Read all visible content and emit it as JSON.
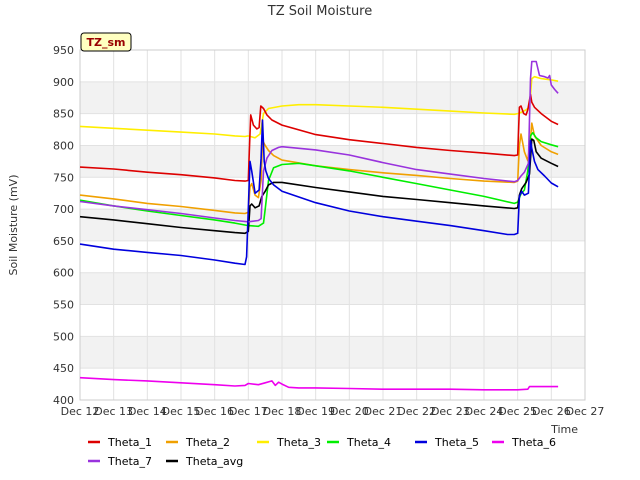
{
  "chart_data": {
    "type": "line",
    "title": "TZ Soil Moisture",
    "xlabel": "Time",
    "ylabel": "Soil Moisture (mV)",
    "badge": "TZ_sm",
    "xlim": [
      12,
      27
    ],
    "ylim": [
      400,
      950
    ],
    "x_ticks": [
      12,
      13,
      14,
      15,
      16,
      17,
      18,
      19,
      20,
      21,
      22,
      23,
      24,
      25,
      26,
      27
    ],
    "x_tick_labels": [
      "Dec 12",
      "Dec 13",
      "Dec 14",
      "Dec 15",
      "Dec 16",
      "Dec 17",
      "Dec 18",
      "Dec 19",
      "Dec 20",
      "Dec 21",
      "Dec 22",
      "Dec 23",
      "Dec 24",
      "Dec 25",
      "Dec 26",
      "Dec 27"
    ],
    "y_ticks": [
      400,
      450,
      500,
      550,
      600,
      650,
      700,
      750,
      800,
      850,
      900,
      950
    ],
    "grid": true,
    "legend_position": "bottom",
    "series": [
      {
        "name": "Theta_1",
        "color": "#dd0000",
        "points": [
          [
            12.0,
            766
          ],
          [
            13.0,
            763
          ],
          [
            14.0,
            758
          ],
          [
            15.0,
            754
          ],
          [
            16.0,
            749
          ],
          [
            16.6,
            745
          ],
          [
            16.9,
            744
          ],
          [
            17.0,
            745
          ],
          [
            17.03,
            790
          ],
          [
            17.07,
            848
          ],
          [
            17.15,
            832
          ],
          [
            17.25,
            826
          ],
          [
            17.32,
            828
          ],
          [
            17.37,
            862
          ],
          [
            17.45,
            858
          ],
          [
            17.55,
            848
          ],
          [
            17.7,
            840
          ],
          [
            18.0,
            832
          ],
          [
            19.0,
            817
          ],
          [
            20.0,
            809
          ],
          [
            21.0,
            803
          ],
          [
            22.0,
            797
          ],
          [
            23.0,
            792
          ],
          [
            24.0,
            788
          ],
          [
            24.9,
            784
          ],
          [
            25.0,
            785
          ],
          [
            25.05,
            860
          ],
          [
            25.1,
            862
          ],
          [
            25.18,
            850
          ],
          [
            25.25,
            848
          ],
          [
            25.3,
            856
          ],
          [
            25.38,
            880
          ],
          [
            25.42,
            868
          ],
          [
            25.5,
            860
          ],
          [
            25.7,
            850
          ],
          [
            26.0,
            838
          ],
          [
            26.2,
            833
          ]
        ]
      },
      {
        "name": "Theta_2",
        "color": "#f0a000",
        "points": [
          [
            12.0,
            722
          ],
          [
            13.0,
            716
          ],
          [
            14.0,
            709
          ],
          [
            15.0,
            704
          ],
          [
            16.0,
            698
          ],
          [
            16.6,
            694
          ],
          [
            16.9,
            693
          ],
          [
            17.0,
            695
          ],
          [
            17.05,
            735
          ],
          [
            17.1,
            740
          ],
          [
            17.2,
            722
          ],
          [
            17.3,
            718
          ],
          [
            17.38,
            745
          ],
          [
            17.42,
            808
          ],
          [
            17.5,
            800
          ],
          [
            17.6,
            792
          ],
          [
            17.75,
            784
          ],
          [
            18.0,
            777
          ],
          [
            19.0,
            768
          ],
          [
            20.0,
            762
          ],
          [
            21.0,
            757
          ],
          [
            22.0,
            753
          ],
          [
            23.0,
            748
          ],
          [
            24.0,
            744
          ],
          [
            24.9,
            742
          ],
          [
            25.0,
            744
          ],
          [
            25.05,
            800
          ],
          [
            25.1,
            818
          ],
          [
            25.2,
            790
          ],
          [
            25.3,
            776
          ],
          [
            25.38,
            810
          ],
          [
            25.42,
            835
          ],
          [
            25.5,
            815
          ],
          [
            25.7,
            800
          ],
          [
            26.0,
            790
          ],
          [
            26.2,
            786
          ]
        ]
      },
      {
        "name": "Theta_3",
        "color": "#ffee00",
        "points": [
          [
            12.0,
            830
          ],
          [
            13.0,
            827
          ],
          [
            14.0,
            824
          ],
          [
            15.0,
            821
          ],
          [
            16.0,
            818
          ],
          [
            16.6,
            815
          ],
          [
            16.9,
            814
          ],
          [
            17.0,
            815
          ],
          [
            17.2,
            812
          ],
          [
            17.35,
            818
          ],
          [
            17.45,
            850
          ],
          [
            17.6,
            858
          ],
          [
            18.0,
            862
          ],
          [
            18.5,
            864
          ],
          [
            19.0,
            864
          ],
          [
            20.0,
            862
          ],
          [
            21.0,
            860
          ],
          [
            22.0,
            857
          ],
          [
            23.0,
            854
          ],
          [
            24.0,
            851
          ],
          [
            24.9,
            849
          ],
          [
            25.0,
            850
          ],
          [
            25.1,
            852
          ],
          [
            25.25,
            856
          ],
          [
            25.35,
            860
          ],
          [
            25.42,
            905
          ],
          [
            25.5,
            908
          ],
          [
            25.7,
            905
          ],
          [
            26.0,
            903
          ],
          [
            26.2,
            901
          ]
        ]
      },
      {
        "name": "Theta_4",
        "color": "#00ee00",
        "points": [
          [
            12.0,
            714
          ],
          [
            13.0,
            705
          ],
          [
            14.0,
            697
          ],
          [
            15.0,
            690
          ],
          [
            16.0,
            683
          ],
          [
            16.6,
            678
          ],
          [
            17.0,
            674
          ],
          [
            17.3,
            673
          ],
          [
            17.45,
            678
          ],
          [
            17.5,
            700
          ],
          [
            17.6,
            745
          ],
          [
            17.75,
            765
          ],
          [
            18.0,
            770
          ],
          [
            18.5,
            772
          ],
          [
            19.0,
            768
          ],
          [
            20.0,
            760
          ],
          [
            21.0,
            750
          ],
          [
            22.0,
            740
          ],
          [
            23.0,
            730
          ],
          [
            24.0,
            720
          ],
          [
            24.9,
            709
          ],
          [
            25.0,
            711
          ],
          [
            25.1,
            724
          ],
          [
            25.2,
            730
          ],
          [
            25.3,
            760
          ],
          [
            25.38,
            815
          ],
          [
            25.45,
            820
          ],
          [
            25.55,
            812
          ],
          [
            25.7,
            806
          ],
          [
            26.0,
            801
          ],
          [
            26.2,
            798
          ]
        ]
      },
      {
        "name": "Theta_5",
        "color": "#0000dd",
        "points": [
          [
            12.0,
            645
          ],
          [
            13.0,
            637
          ],
          [
            14.0,
            632
          ],
          [
            15.0,
            627
          ],
          [
            16.0,
            620
          ],
          [
            16.6,
            615
          ],
          [
            16.9,
            613
          ],
          [
            16.95,
            625
          ],
          [
            17.0,
            700
          ],
          [
            17.05,
            775
          ],
          [
            17.1,
            760
          ],
          [
            17.2,
            725
          ],
          [
            17.32,
            730
          ],
          [
            17.38,
            780
          ],
          [
            17.42,
            840
          ],
          [
            17.47,
            775
          ],
          [
            17.52,
            760
          ],
          [
            17.6,
            748
          ],
          [
            17.75,
            738
          ],
          [
            18.0,
            728
          ],
          [
            19.0,
            710
          ],
          [
            20.0,
            697
          ],
          [
            21.0,
            688
          ],
          [
            22.0,
            681
          ],
          [
            23.0,
            674
          ],
          [
            24.0,
            666
          ],
          [
            24.7,
            660
          ],
          [
            24.9,
            660
          ],
          [
            25.0,
            662
          ],
          [
            25.05,
            720
          ],
          [
            25.12,
            728
          ],
          [
            25.2,
            722
          ],
          [
            25.32,
            725
          ],
          [
            25.38,
            808
          ],
          [
            25.42,
            795
          ],
          [
            25.5,
            775
          ],
          [
            25.6,
            762
          ],
          [
            25.8,
            752
          ],
          [
            26.0,
            741
          ],
          [
            26.2,
            735
          ]
        ]
      },
      {
        "name": "Theta_6",
        "color": "#ee00ee",
        "points": [
          [
            12.0,
            435
          ],
          [
            13.0,
            432
          ],
          [
            14.0,
            430
          ],
          [
            15.0,
            427
          ],
          [
            16.0,
            424
          ],
          [
            16.6,
            422
          ],
          [
            16.9,
            423
          ],
          [
            17.0,
            426
          ],
          [
            17.3,
            424
          ],
          [
            17.5,
            427
          ],
          [
            17.7,
            430
          ],
          [
            17.8,
            423
          ],
          [
            17.9,
            428
          ],
          [
            18.0,
            425
          ],
          [
            18.2,
            420
          ],
          [
            18.5,
            419
          ],
          [
            19.0,
            419
          ],
          [
            20.0,
            418
          ],
          [
            21.0,
            417
          ],
          [
            22.0,
            417
          ],
          [
            23.0,
            417
          ],
          [
            24.0,
            416
          ],
          [
            24.9,
            416
          ],
          [
            25.0,
            416
          ],
          [
            25.3,
            417
          ],
          [
            25.35,
            421
          ],
          [
            25.5,
            421
          ],
          [
            26.0,
            421
          ],
          [
            26.2,
            421
          ]
        ]
      },
      {
        "name": "Theta_7",
        "color": "#9933dd",
        "points": [
          [
            12.0,
            712
          ],
          [
            13.0,
            705
          ],
          [
            14.0,
            699
          ],
          [
            15.0,
            693
          ],
          [
            16.0,
            686
          ],
          [
            16.6,
            682
          ],
          [
            17.0,
            680
          ],
          [
            17.3,
            682
          ],
          [
            17.38,
            685
          ],
          [
            17.45,
            760
          ],
          [
            17.55,
            780
          ],
          [
            17.7,
            792
          ],
          [
            17.9,
            797
          ],
          [
            18.0,
            798
          ],
          [
            19.0,
            793
          ],
          [
            20.0,
            785
          ],
          [
            21.0,
            773
          ],
          [
            22.0,
            762
          ],
          [
            23.0,
            755
          ],
          [
            24.0,
            748
          ],
          [
            24.9,
            743
          ],
          [
            25.0,
            745
          ],
          [
            25.1,
            752
          ],
          [
            25.2,
            758
          ],
          [
            25.32,
            772
          ],
          [
            25.38,
            905
          ],
          [
            25.42,
            932
          ],
          [
            25.55,
            932
          ],
          [
            25.65,
            910
          ],
          [
            25.8,
            908
          ],
          [
            25.9,
            906
          ],
          [
            25.95,
            910
          ],
          [
            26.0,
            895
          ],
          [
            26.1,
            888
          ],
          [
            26.2,
            882
          ]
        ]
      },
      {
        "name": "Theta_avg",
        "color": "#000000",
        "points": [
          [
            12.0,
            688
          ],
          [
            13.0,
            683
          ],
          [
            14.0,
            677
          ],
          [
            15.0,
            671
          ],
          [
            16.0,
            666
          ],
          [
            16.6,
            663
          ],
          [
            16.9,
            662
          ],
          [
            17.0,
            665
          ],
          [
            17.05,
            705
          ],
          [
            17.1,
            708
          ],
          [
            17.2,
            702
          ],
          [
            17.32,
            705
          ],
          [
            17.4,
            720
          ],
          [
            17.5,
            728
          ],
          [
            17.6,
            738
          ],
          [
            17.75,
            742
          ],
          [
            18.0,
            742
          ],
          [
            19.0,
            734
          ],
          [
            20.0,
            727
          ],
          [
            21.0,
            720
          ],
          [
            22.0,
            715
          ],
          [
            23.0,
            710
          ],
          [
            24.0,
            705
          ],
          [
            24.9,
            701
          ],
          [
            25.0,
            702
          ],
          [
            25.05,
            722
          ],
          [
            25.12,
            732
          ],
          [
            25.25,
            742
          ],
          [
            25.35,
            755
          ],
          [
            25.42,
            810
          ],
          [
            25.48,
            808
          ],
          [
            25.55,
            790
          ],
          [
            25.7,
            780
          ],
          [
            26.0,
            772
          ],
          [
            26.2,
            767
          ]
        ]
      }
    ]
  }
}
